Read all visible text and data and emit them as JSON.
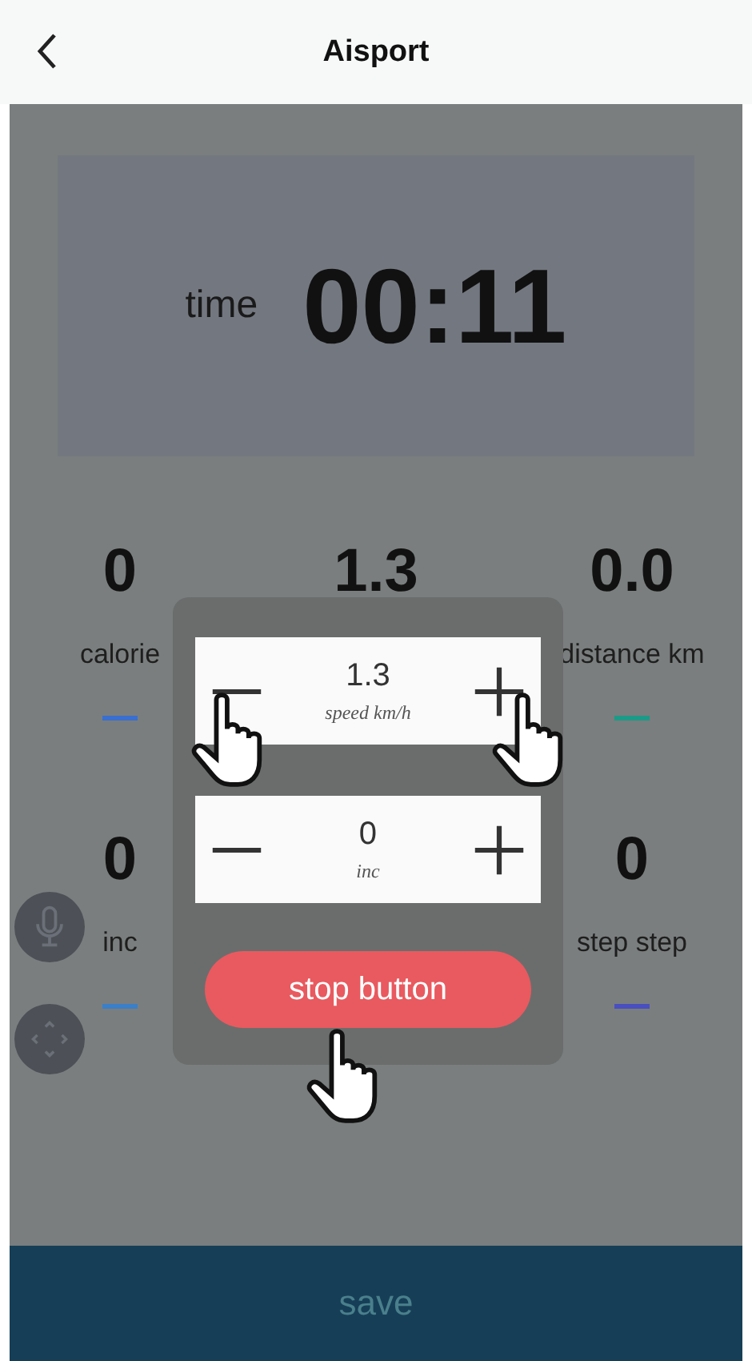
{
  "header": {
    "title": "Aisport"
  },
  "timer": {
    "label": "time",
    "value": "00:11"
  },
  "stats": {
    "left": [
      {
        "value": "0",
        "label": "calorie",
        "color": "#3a6fd0"
      },
      {
        "value": "0",
        "label": "inc",
        "color": "#3a7fc8"
      }
    ],
    "center": [
      {
        "value": "1.3"
      }
    ],
    "right": [
      {
        "value": "0.0",
        "label": "distance km",
        "color": "#1c9a88"
      },
      {
        "value": "0",
        "label": "step step",
        "color": "#4a4fc0"
      }
    ]
  },
  "dialog": {
    "steppers": [
      {
        "value": "1.3",
        "label": "speed km/h"
      },
      {
        "value": "0",
        "label": "inc"
      }
    ],
    "stop_button": "stop button"
  },
  "save_button": "save"
}
